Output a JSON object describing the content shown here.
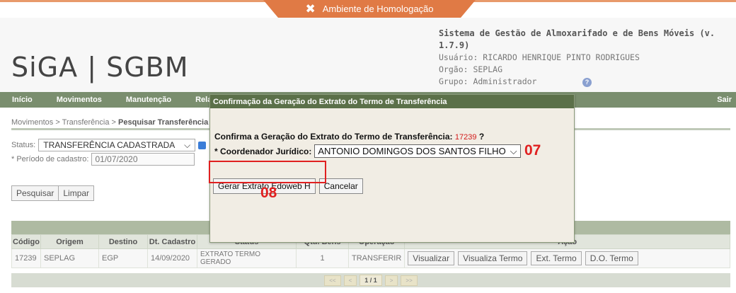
{
  "environment_label": "Ambiente de Homologação",
  "logo_text": "SiGA | SGBM",
  "system": {
    "title": "Sistema de Gestão de Almoxarifado e de Bens Móveis (v. 1.7.9)",
    "user": "Usuário: RICARDO HENRIQUE PINTO RODRIGUES",
    "org": "Orgão: SEPLAG",
    "group": "Grupo: Administrador"
  },
  "help_icon": "?",
  "nav": {
    "items": [
      "Início",
      "Movimentos",
      "Manutenção",
      "Relató"
    ],
    "sair": "Sair"
  },
  "breadcrumb": {
    "part1": "Movimentos",
    "sep": " > ",
    "part2": "Transferência",
    "current": "Pesquisar Transferência"
  },
  "filters": {
    "status_label": "Status:",
    "status_value": "TRANSFERÊNCIA CADASTRADA",
    "period_label": "* Período de cadastro:",
    "period_value": "01/07/2020"
  },
  "buttons": {
    "pesquisar": "Pesquisar",
    "limpar": "Limpar"
  },
  "table": {
    "headers": [
      "Código",
      "Origem",
      "Destino",
      "Dt. Cadastro",
      "Status",
      "Qtd. Bens",
      "Operação",
      "Ação"
    ],
    "rows": [
      {
        "codigo": "17239",
        "origem": "SEPLAG",
        "destino": "EGP",
        "dt_cadastro": "14/09/2020",
        "status_line1": "EXTRATO TERMO",
        "status_line2": "GERADO",
        "qtd_bens": "1",
        "operacao": "TRANSFERIR",
        "actions": [
          "Visualizar",
          "Visualiza Termo",
          "Ext. Termo",
          "D.O. Termo"
        ]
      }
    ]
  },
  "pager": {
    "first": "<<",
    "prev": "<",
    "current": "1 / 1",
    "next": ">",
    "last": ">>"
  },
  "modal": {
    "title": "Confirmação da Geração do Extrato do Termo de Transferência",
    "question": "Confirma a Geração do Extrato do Termo de Transferência:",
    "term_number": "17239",
    "question_end": "?",
    "coord_label": "* Coordenador Jurídico:",
    "coord_value": "ANTONIO DOMINGOS DOS SANTOS FILHO",
    "btn_generate": "Gerar Extrato Edoweb H",
    "btn_cancel": "Cancelar"
  },
  "annotations": {
    "step07": "07",
    "step08": "08",
    "highlight_color": "#e02020"
  }
}
